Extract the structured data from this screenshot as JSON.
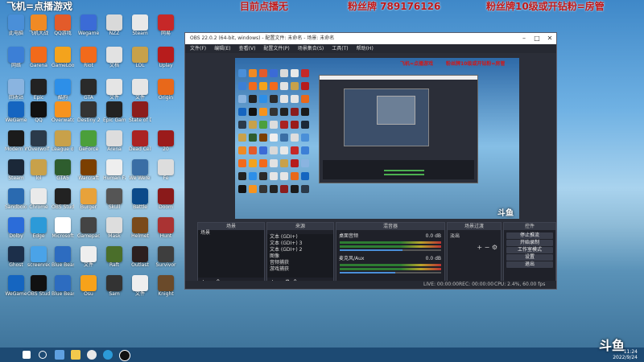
{
  "overlay": {
    "left_text": "飞机=点播游戏",
    "mid_text": "目前点播无",
    "right_text": "粉丝牌 789176126",
    "far_text": "粉丝牌10级或开钻粉=房管"
  },
  "desktop": {
    "icons": [
      {
        "label": "此电脑",
        "color": "#4a8fd8"
      },
      {
        "label": "飞机大战",
        "color": "#f08a24"
      },
      {
        "label": "QQ游戏",
        "color": "#e35b2a"
      },
      {
        "label": "Wegame",
        "color": "#3b6bd6"
      },
      {
        "label": "NZZ",
        "color": "#d9d9d9"
      },
      {
        "label": "Steam",
        "color": "#e8e8e8"
      },
      {
        "label": "网易",
        "color": "#c62828"
      },
      {
        "label": "网络",
        "color": "#3c7fd6"
      },
      {
        "label": "Garena",
        "color": "#f26a1b"
      },
      {
        "label": "GameLoop",
        "color": "#f4a31c"
      },
      {
        "label": "Riot",
        "color": "#f26a1b"
      },
      {
        "label": "文档",
        "color": "#e2e2e2"
      },
      {
        "label": "LOL",
        "color": "#c8a14a"
      },
      {
        "label": "Uplay",
        "color": "#b71c1c"
      },
      {
        "label": "回收站",
        "color": "#8ab4e0"
      },
      {
        "label": "Epic",
        "color": "#222"
      },
      {
        "label": "酷狗",
        "color": "#2d8fe8"
      },
      {
        "label": "GTA",
        "color": "#2a2a2a"
      },
      {
        "label": "文件",
        "color": "#e5e5e5"
      },
      {
        "label": "文件",
        "color": "#e5e5e5"
      },
      {
        "label": "Origin",
        "color": "#e8681a"
      }
    ],
    "row2": [
      {
        "label": "WeGame",
        "color": "#1565c0"
      },
      {
        "label": "QQ",
        "color": "#111"
      },
      {
        "label": "Overwatch",
        "color": "#f7931e"
      },
      {
        "label": "Destiny 2",
        "color": "#333"
      },
      {
        "label": "Epic Games Launcher",
        "color": "#222"
      },
      {
        "label": "State of Decay 2",
        "color": "#8b1d1d"
      }
    ],
    "row3": [
      {
        "label": "Modern Warfare",
        "color": "#1b1b1b"
      },
      {
        "label": "Overwolf",
        "color": "#2b3a4a"
      },
      {
        "label": "League of Legends",
        "color": "#c8a14a"
      },
      {
        "label": "GeForce",
        "color": "#4b9f3b"
      },
      {
        "label": "Arena",
        "color": "#ddd"
      },
      {
        "label": "Dead Cells",
        "color": "#a22"
      },
      {
        "label": "20",
        "color": "#9b1b1b"
      }
    ],
    "row4": [
      {
        "label": "Steam",
        "color": "#1b2838"
      },
      {
        "label": "lol",
        "color": "#c8a14a"
      },
      {
        "label": "GTA5",
        "color": "#2e5d2e"
      },
      {
        "label": "Warcraft",
        "color": "#7b3f00"
      },
      {
        "label": "Human Fall Flat",
        "color": "#eee"
      },
      {
        "label": "We Were Here",
        "color": "#3a6ea5"
      },
      {
        "label": "Fe",
        "color": "#ddd"
      }
    ],
    "row5": [
      {
        "label": "Sandboxie",
        "color": "#2a6ab0"
      },
      {
        "label": "Chrome",
        "color": "#eaeaea"
      },
      {
        "label": "OBS Studio",
        "color": "#222"
      },
      {
        "label": "Burger",
        "color": "#e8a23a"
      },
      {
        "label": "Skull",
        "color": "#555"
      },
      {
        "label": "Battle",
        "color": "#0b4a8a"
      },
      {
        "label": "Doom",
        "color": "#8a1a1a"
      }
    ],
    "row6": [
      {
        "label": "Dolby",
        "color": "#2b6cd9"
      },
      {
        "label": "Edge",
        "color": "#2c9ad8"
      },
      {
        "label": "Microsoft",
        "color": "#fff"
      },
      {
        "label": "Gamepad",
        "color": "#444"
      },
      {
        "label": "Mask",
        "color": "#ddd"
      },
      {
        "label": "Helmet",
        "color": "#7a4a1a"
      },
      {
        "label": "Hunt",
        "color": "#a33"
      }
    ],
    "row7": [
      {
        "label": "Ghost",
        "color": "#1c2f4a"
      },
      {
        "label": "screenrecorder",
        "color": "#4aa3e8"
      },
      {
        "label": "Blue Beast",
        "color": "#2d6cc0"
      },
      {
        "label": "文件",
        "color": "#eee"
      },
      {
        "label": "Raft",
        "color": "#4a6e2a"
      },
      {
        "label": "Outlast",
        "color": "#2c1f1f"
      },
      {
        "label": "Survivor",
        "color": "#3e3e3e"
      }
    ],
    "row8": [
      {
        "label": "WeGame",
        "color": "#1565c0"
      },
      {
        "label": "OBS Studio",
        "color": "#111"
      },
      {
        "label": "Blue Beast",
        "color": "#2d6cc0"
      },
      {
        "label": "Osu",
        "color": "#f7a21a"
      },
      {
        "label": "Sam",
        "color": "#333"
      },
      {
        "label": "文件",
        "color": "#eee"
      },
      {
        "label": "Knight",
        "color": "#6a4a2a"
      }
    ]
  },
  "obs": {
    "title": "OBS 22.0.2 (64-bit, windows) - 配置文件: 未命名 - 场景: 未命名",
    "menu": [
      "文件(F)",
      "编辑(E)",
      "查看(V)",
      "配置文件(P)",
      "场景集合(S)",
      "工具(T)",
      "帮助(H)"
    ],
    "docks": {
      "scenes": {
        "title": "场景",
        "item": "场景",
        "footer": "+ − ⌃ ⌄"
      },
      "sources": {
        "title": "来源",
        "items": [
          "文本 (GDI+)",
          "文本 (GDI+) 3",
          "文本 (GDI+) 2",
          "图像",
          "音频捕获",
          "游戏捕获"
        ],
        "footer": "+ − ⚙ ⌃ ⌄"
      },
      "mixer": {
        "title": "混音器",
        "channels": [
          {
            "name": "桌面音频",
            "db": "0.0 dB",
            "level": 0.62
          },
          {
            "name": "麦克风/Aux",
            "db": "0.0 dB",
            "level": 0.55
          }
        ]
      },
      "transitions": {
        "title": "场景过渡",
        "value": "淡出",
        "footer": "+ − ⚙"
      },
      "controls": {
        "title": "控件",
        "buttons": [
          "停止推流",
          "开始录制",
          "工作室模式",
          "设置",
          "退出"
        ]
      }
    },
    "status": {
      "live": "LIVE: 00:00:00",
      "rec": "REC: 00:00:00",
      "cpu": "CPU: 2.4%, 60.00 fps"
    },
    "preview_overlay": {
      "left": "飞机=点播游戏",
      "right": "粉丝牌10级或开钻粉=房管"
    }
  },
  "taskbar": {
    "time": "11:24",
    "date": "2022/9/24",
    "icons": [
      "start",
      "search",
      "taskview",
      "explorer",
      "chrome",
      "edge",
      "obs"
    ]
  },
  "watermark": {
    "brand": "斗鱼",
    "preview_brand": "斗鱼"
  },
  "colors": {
    "accent": "#c01818",
    "obs_bg": "#2b2e38",
    "taskbar": "#1d4a73"
  }
}
